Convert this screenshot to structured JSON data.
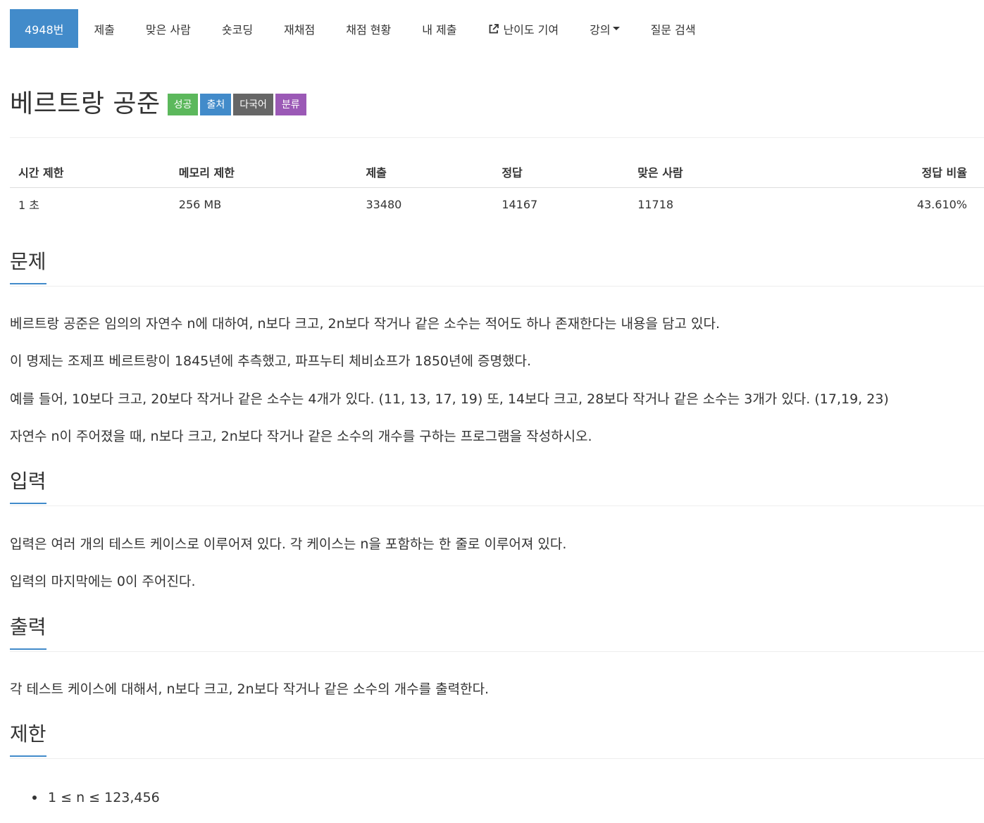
{
  "nav": {
    "items": [
      {
        "label": "4948번",
        "active": true
      },
      {
        "label": "제출"
      },
      {
        "label": "맞은 사람"
      },
      {
        "label": "숏코딩"
      },
      {
        "label": "재채점"
      },
      {
        "label": "채점 현황"
      },
      {
        "label": "내 제출"
      },
      {
        "label": "난이도 기여",
        "icon": "external-link-icon"
      },
      {
        "label": "강의",
        "icon": "caret-down-icon"
      },
      {
        "label": "질문 검색"
      }
    ]
  },
  "problem": {
    "title": "베르트랑 공준",
    "badges": [
      "성공",
      "출처",
      "다국어",
      "분류"
    ]
  },
  "colors": {
    "primary": "#428bca",
    "success": "#5cb85c",
    "gray": "#666666",
    "purple": "#9b59b6"
  },
  "info_table": {
    "headers": [
      "시간 제한",
      "메모리 제한",
      "제출",
      "정답",
      "맞은 사람",
      "정답 비율"
    ],
    "values": [
      "1 초",
      "256 MB",
      "33480",
      "14167",
      "11718",
      "43.610%"
    ]
  },
  "sections": {
    "description": {
      "title": "문제",
      "paragraphs": [
        "베르트랑 공준은 임의의 자연수 n에 대하여, n보다 크고, 2n보다 작거나 같은 소수는 적어도 하나 존재한다는 내용을 담고 있다.",
        "이 명제는 조제프 베르트랑이 1845년에 추측했고, 파프누티 체비쇼프가 1850년에 증명했다.",
        "예를 들어, 10보다 크고, 20보다 작거나 같은 소수는 4개가 있다. (11, 13, 17, 19) 또, 14보다 크고, 28보다 작거나 같은 소수는 3개가 있다. (17,19, 23)",
        "자연수 n이 주어졌을 때, n보다 크고, 2n보다 작거나 같은 소수의 개수를 구하는 프로그램을 작성하시오."
      ]
    },
    "input": {
      "title": "입력",
      "paragraphs": [
        "입력은 여러 개의 테스트 케이스로 이루어져 있다. 각 케이스는 n을 포함하는 한 줄로 이루어져 있다.",
        "입력의 마지막에는 0이 주어진다."
      ]
    },
    "output": {
      "title": "출력",
      "paragraphs": [
        "각 테스트 케이스에 대해서, n보다 크고, 2n보다 작거나 같은 소수의 개수를 출력한다."
      ]
    },
    "limit": {
      "title": "제한",
      "items": [
        "1 ≤ n ≤ 123,456"
      ]
    }
  }
}
